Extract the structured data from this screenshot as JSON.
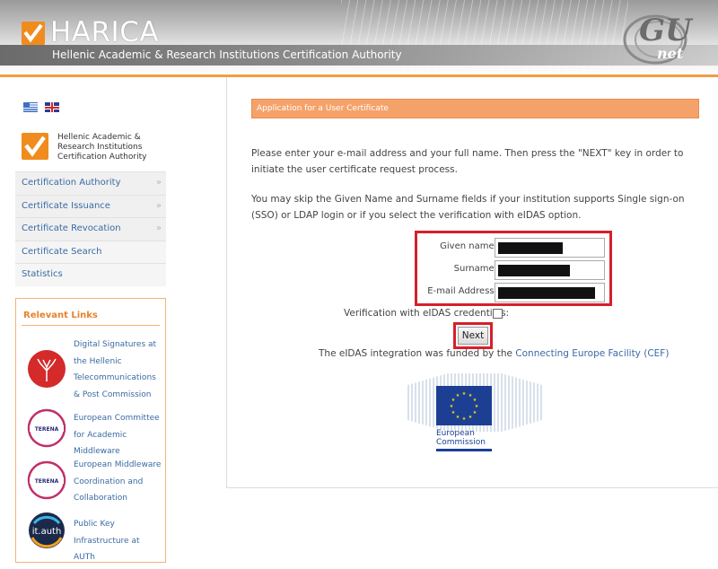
{
  "header": {
    "brand": "HARICA",
    "subtitle": "Hellenic Academic & Research Institutions Certification Authority",
    "partner_logo_main": "GU",
    "partner_logo_sub": "net"
  },
  "sidebar": {
    "languages": [
      "Greek",
      "English"
    ],
    "org_name": "Hellenic Academic & Research Institutions Certification Authority",
    "menu": [
      {
        "label": "Certification Authority",
        "has_arrow": true
      },
      {
        "label": "Certificate Issuance",
        "has_arrow": true
      },
      {
        "label": "Certificate Revocation",
        "has_arrow": true
      },
      {
        "label": "Certificate Search",
        "has_arrow": false
      },
      {
        "label": "Statistics",
        "has_arrow": false
      }
    ],
    "arrow_glyph": "»",
    "relevant_links": {
      "title": "Relevant Links",
      "items": [
        {
          "label": "Digital Signatures at the Hellenic Telecommunications & Post Commission",
          "icon": "tree-seal-icon"
        },
        {
          "label": "European Committee for Academic Middleware",
          "icon": "terena-logo-icon",
          "icon_text": "TERENA"
        },
        {
          "label": "European Middleware Coordination and Collaboration",
          "icon": "terena-logo-icon",
          "icon_text": "TERENA"
        },
        {
          "label": "Public Key Infrastructure at AUTh",
          "icon": "itauth-logo-icon",
          "icon_text": "it.auth"
        }
      ]
    }
  },
  "main": {
    "title": "Application for a User Certificate",
    "intro": "Please enter your e-mail address and your full name. Then press the \"NEXT\" key in order to initiate the user certificate request process.",
    "skip_note": "You may skip the Given Name and Surname fields if your institution supports Single sign-on (SSO) or LDAP login or if you select the verification with eIDAS option.",
    "form": {
      "given_name_label": "Given name:",
      "surname_label": "Surname:",
      "email_label": "E-mail Address:"
    },
    "eidas_label": "Verification with eIDAS credentials:",
    "eidas_checked": false,
    "next_label": "Next",
    "cef_prefix": "The eIDAS integration was funded by the",
    "cef_link": "Connecting Europe Facility (CEF)",
    "ec_caption_line1": "European",
    "ec_caption_line2": "Commission"
  },
  "colors": {
    "accent_orange": "#f5a26a",
    "highlight_red": "#d6202a",
    "link_blue": "#3a6aa3",
    "eu_blue": "#1c3f94",
    "eu_star": "#ffdd00"
  }
}
